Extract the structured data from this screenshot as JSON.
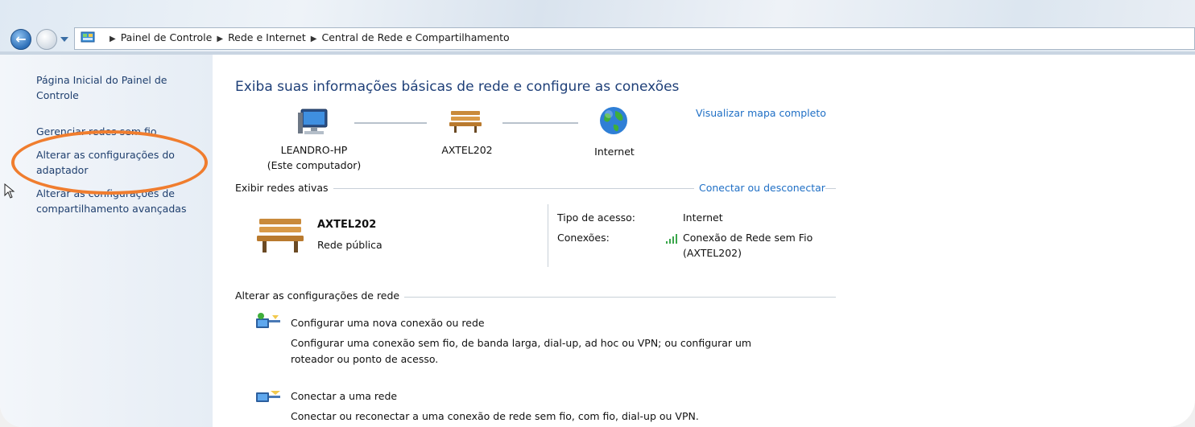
{
  "breadcrumb": {
    "items": [
      "Painel de Controle",
      "Rede e Internet",
      "Central de Rede e Compartilhamento"
    ]
  },
  "sidebar": {
    "items": [
      {
        "label": "Página Inicial do Painel de Controle"
      },
      {
        "label": "Gerenciar redes sem fio"
      },
      {
        "label": "Alterar as configurações do adaptador"
      },
      {
        "label": "Alterar as configurações de compartilhamento avançadas"
      }
    ]
  },
  "main": {
    "title": "Exiba suas informações básicas de rede e configure as conexões",
    "map_link": "Visualizar mapa completo",
    "map": {
      "computer_name": "LEANDRO-HP",
      "computer_sub": "(Este computador)",
      "network_name": "AXTEL202",
      "internet_label": "Internet"
    },
    "active": {
      "heading": "Exibir redes ativas",
      "connect_link": "Conectar ou desconectar",
      "network_name": "AXTEL202",
      "network_type": "Rede pública",
      "access_label": "Tipo de acesso:",
      "access_value": "Internet",
      "connections_label": "Conexões:",
      "connection_line1": "Conexão de Rede sem Fio",
      "connection_line2": "(AXTEL202)"
    },
    "change": {
      "heading": "Alterar as configurações de rede",
      "tasks": [
        {
          "title": "Configurar uma nova conexão ou rede",
          "desc_line1": "Configurar uma conexão sem fio, de banda larga, dial-up, ad hoc ou VPN; ou configurar um",
          "desc_line2": "roteador ou ponto de acesso."
        },
        {
          "title": "Conectar a uma rede",
          "desc_line1": "Conectar ou reconectar a uma conexão de rede sem fio, com fio, dial-up ou VPN."
        }
      ]
    }
  },
  "colors": {
    "link": "#1f6fc5",
    "title": "#1e3f78",
    "highlight": "#f07d2e"
  }
}
